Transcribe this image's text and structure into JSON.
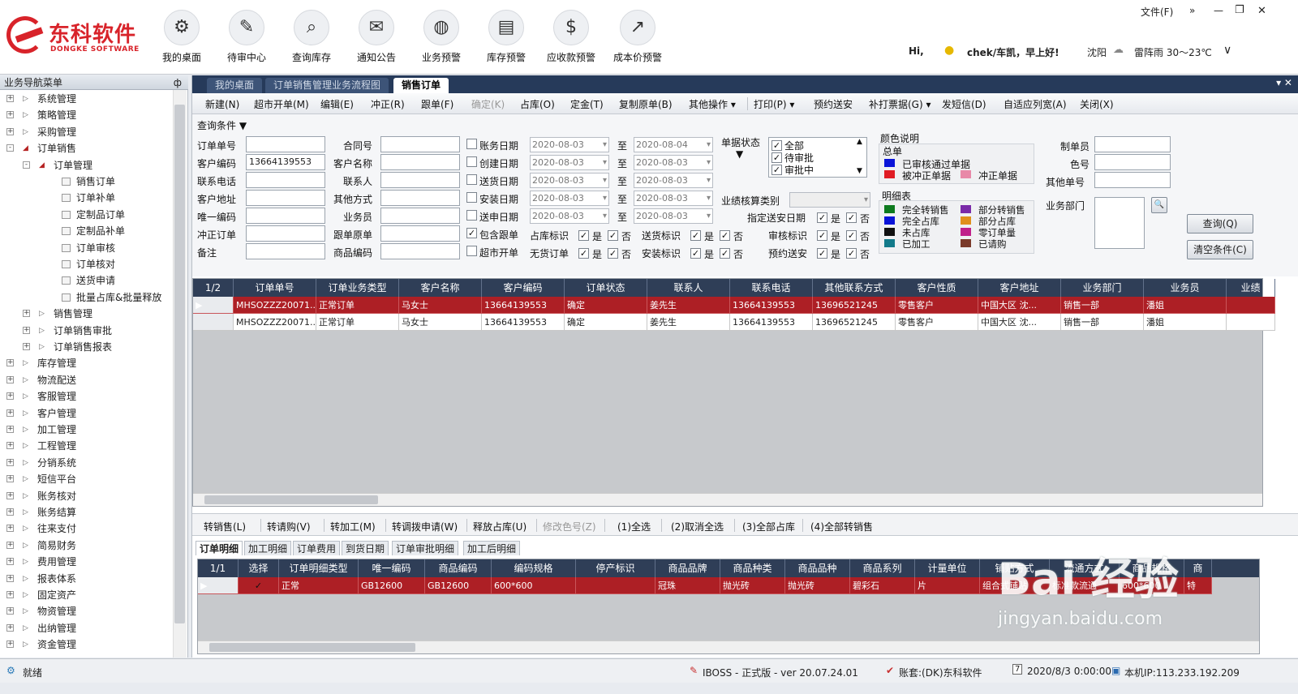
{
  "app": {
    "logo_cn": "东科软件",
    "logo_en": "DONGKE SOFTWARE",
    "nav": [
      {
        "label": "我的桌面",
        "icon": "desktop-icon"
      },
      {
        "label": "待审中心",
        "icon": "pending-review-icon"
      },
      {
        "label": "查询库存",
        "icon": "search-inventory-icon"
      },
      {
        "label": "通知公告",
        "icon": "notice-icon"
      },
      {
        "label": "业务预警",
        "icon": "business-alert-icon"
      },
      {
        "label": "库存预警",
        "icon": "inventory-alert-icon"
      },
      {
        "label": "应收款预警",
        "icon": "receivable-alert-icon"
      },
      {
        "label": "成本价预警",
        "icon": "cost-alert-icon"
      }
    ],
    "file_menu": "文件(F)",
    "more": "»",
    "greeting_hi": "Hi,",
    "greeting_user": "chek/车凯，早上好!",
    "city": "沈阳",
    "weather": "雷阵雨 30～23℃"
  },
  "sidebar": {
    "title": "业务导航菜单",
    "pin": "ф",
    "items": [
      {
        "label": "系统管理",
        "level": 0,
        "expand": "+"
      },
      {
        "label": "策略管理",
        "level": 0,
        "expand": "+"
      },
      {
        "label": "采购管理",
        "level": 0,
        "expand": "+"
      },
      {
        "label": "订单销售",
        "level": 0,
        "expand": "-"
      },
      {
        "label": "订单管理",
        "level": 1,
        "expand": "-"
      },
      {
        "label": "销售订单",
        "level": 2
      },
      {
        "label": "订单补单",
        "level": 2
      },
      {
        "label": "定制品订单",
        "level": 2
      },
      {
        "label": "定制品补单",
        "level": 2
      },
      {
        "label": "订单审核",
        "level": 2
      },
      {
        "label": "订单核对",
        "level": 2
      },
      {
        "label": "送货申请",
        "level": 2
      },
      {
        "label": "批量占库&批量释放",
        "level": 2
      },
      {
        "label": "销售管理",
        "level": 1,
        "expand": "+"
      },
      {
        "label": "订单销售审批",
        "level": 1,
        "expand": "+"
      },
      {
        "label": "订单销售报表",
        "level": 1,
        "expand": "+"
      },
      {
        "label": "库存管理",
        "level": 0,
        "expand": "+"
      },
      {
        "label": "物流配送",
        "level": 0,
        "expand": "+"
      },
      {
        "label": "客服管理",
        "level": 0,
        "expand": "+"
      },
      {
        "label": "客户管理",
        "level": 0,
        "expand": "+"
      },
      {
        "label": "加工管理",
        "level": 0,
        "expand": "+"
      },
      {
        "label": "工程管理",
        "level": 0,
        "expand": "+"
      },
      {
        "label": "分销系统",
        "level": 0,
        "expand": "+"
      },
      {
        "label": "短信平台",
        "level": 0,
        "expand": "+"
      },
      {
        "label": "账务核对",
        "level": 0,
        "expand": "+"
      },
      {
        "label": "账务结算",
        "level": 0,
        "expand": "+"
      },
      {
        "label": "往来支付",
        "level": 0,
        "expand": "+"
      },
      {
        "label": "简易财务",
        "level": 0,
        "expand": "+"
      },
      {
        "label": "费用管理",
        "level": 0,
        "expand": "+"
      },
      {
        "label": "报表体系",
        "level": 0,
        "expand": "+"
      },
      {
        "label": "固定资产",
        "level": 0,
        "expand": "+"
      },
      {
        "label": "物资管理",
        "level": 0,
        "expand": "+"
      },
      {
        "label": "出纳管理",
        "level": 0,
        "expand": "+"
      },
      {
        "label": "资金管理",
        "level": 0,
        "expand": "+"
      }
    ]
  },
  "tabs": [
    "我的桌面",
    "订单销售管理业务流程图",
    "销售订单"
  ],
  "tab_ctrl": "▾ ✕",
  "toolbar": [
    "新建(N)",
    "超市开单(M)",
    "编辑(E)",
    "冲正(R)",
    "跟单(F)",
    "确定(K)",
    "占库(O)",
    "定金(T)",
    "复制原单(B)",
    "其他操作 ▾",
    "打印(P) ▾",
    "预约送安",
    "补打票据(G) ▾",
    "发短信(D)",
    "自适应列宽(A)",
    "关闭(X)"
  ],
  "query": {
    "header": "查询条件 ▼",
    "col1": [
      {
        "label": "订单单号",
        "value": ""
      },
      {
        "label": "客户编码",
        "value": "13664139553"
      },
      {
        "label": "联系电话",
        "value": ""
      },
      {
        "label": "客户地址",
        "value": ""
      },
      {
        "label": "唯一编码",
        "value": ""
      },
      {
        "label": "冲正订单",
        "value": ""
      },
      {
        "label": "备注",
        "value": ""
      }
    ],
    "col2": [
      {
        "label": "合同号",
        "value": ""
      },
      {
        "label": "客户名称",
        "value": ""
      },
      {
        "label": "联系人",
        "value": ""
      },
      {
        "label": "其他方式",
        "value": ""
      },
      {
        "label": "业务员",
        "value": ""
      },
      {
        "label": "跟单原单",
        "value": ""
      },
      {
        "label": "商品编码",
        "value": ""
      }
    ],
    "dates": [
      {
        "label": "账务日期",
        "from": "2020-08-03",
        "to": "2020-08-04",
        "checked": false
      },
      {
        "label": "创建日期",
        "from": "2020-08-03",
        "to": "2020-08-03",
        "checked": false
      },
      {
        "label": "送货日期",
        "from": "2020-08-03",
        "to": "2020-08-03",
        "checked": false
      },
      {
        "label": "安装日期",
        "from": "2020-08-03",
        "to": "2020-08-03",
        "checked": false
      },
      {
        "label": "送申日期",
        "from": "2020-08-03",
        "to": "2020-08-03",
        "checked": false
      }
    ],
    "to_label": "至",
    "include_follow": "包含跟单",
    "supermarket": "超市开单",
    "flags_row1": [
      "占库标识",
      "送货标识"
    ],
    "flags_row2": [
      "无货订单",
      "安装标识"
    ],
    "yes": "是",
    "no": "否",
    "check": "✓",
    "doc_status_label": "单据状态",
    "doc_status_arrow": "▼",
    "doc_status": [
      "全部",
      "待审批",
      "审批中"
    ],
    "perf_label": "业绩核算类别",
    "right_flags": [
      "指定送安日期",
      "审核标识",
      "预约送安"
    ],
    "color_legend": {
      "title": "颜色说明",
      "summary": "总单",
      "summary_items": [
        {
          "label": "已审核通过单据",
          "color": "#0a14d8"
        },
        {
          "label": "被冲正单据",
          "color": "#e01c24"
        },
        {
          "label": "冲正单据",
          "color": "#e889a8"
        }
      ],
      "detail": "明细表",
      "detail_items": [
        {
          "label": "完全转销售",
          "color": "#0d7a1e"
        },
        {
          "label": "部分转销售",
          "color": "#7a2aa8"
        },
        {
          "label": "完全占库",
          "color": "#0a14d8"
        },
        {
          "label": "部分占库",
          "color": "#e0901c"
        },
        {
          "label": "未占库",
          "color": "#111111"
        },
        {
          "label": "零订单量",
          "color": "#c0208a"
        },
        {
          "label": "已加工",
          "color": "#127a8a"
        },
        {
          "label": "已请购",
          "color": "#7a3a2a"
        }
      ]
    },
    "maker_label": "制单员",
    "color_no_label": "色号",
    "other_no_label": "其他单号",
    "dept_label": "业务部门",
    "query_btn": "查询(Q)",
    "clear_btn": "清空条件(C)",
    "lookup_icon": "🔍"
  },
  "orders": {
    "count": "1/2",
    "headers": [
      "订单单号",
      "订单业务类型",
      "客户名称",
      "客户编码",
      "订单状态",
      "联系人",
      "联系电话",
      "其他联系方式",
      "客户性质",
      "客户地址",
      "业务部门",
      "业务员",
      "业绩"
    ],
    "rows": [
      [
        "MHSOZZZ20071...",
        "正常订单",
        "马女士",
        "13664139553",
        "确定",
        "姜先生",
        "13664139553",
        "13696521245",
        "零售客户",
        "中国大区 沈...",
        "销售一部",
        "潘姐",
        ""
      ],
      [
        "MHSOZZZ20071...",
        "正常订单",
        "马女士",
        "13664139553",
        "确定",
        "姜先生",
        "13664139553",
        "13696521245",
        "零售客户",
        "中国大区 沈...",
        "销售一部",
        "潘姐",
        ""
      ]
    ]
  },
  "bottom_toolbar": [
    "转销售(L)",
    "转请购(V)",
    "转加工(M)",
    "转调拨申请(W)",
    "释放占库(U)",
    "修改色号(Z)",
    "(1)全选",
    "(2)取消全选",
    "(3)全部占库",
    "(4)全部转销售"
  ],
  "detail_tabs": [
    "订单明细",
    "加工明细",
    "订单费用",
    "到货日期",
    "订单审批明细",
    "加工后明细"
  ],
  "details": {
    "count": "1/1",
    "headers": [
      "选择",
      "订单明细类型",
      "唯一编码",
      "商品编码",
      "编码规格",
      "停产标识",
      "商品品牌",
      "商品种类",
      "商品品种",
      "商品系列",
      "计量单位",
      "铺贴方式",
      "流通方式",
      "商品规格",
      "商"
    ],
    "rows": [
      [
        "✓",
        "正常",
        "GB12600",
        "GB12600",
        "600*600",
        "",
        "冠珠",
        "抛光砖",
        "抛光砖",
        "碧彩石",
        "片",
        "组合式铺贴",
        "标准款流通",
        "600*600",
        "特"
      ]
    ]
  },
  "status": {
    "ready": "就绪",
    "version": "IBOSS - 正式版 - ver 20.07.24.01",
    "account": "账套:(DK)东科软件",
    "time": "2020/8/3 0:00:00",
    "ip": "本机IP:113.233.192.209"
  },
  "watermark": {
    "main": "Bai 经验",
    "sub": "jingyan.baidu.com"
  }
}
